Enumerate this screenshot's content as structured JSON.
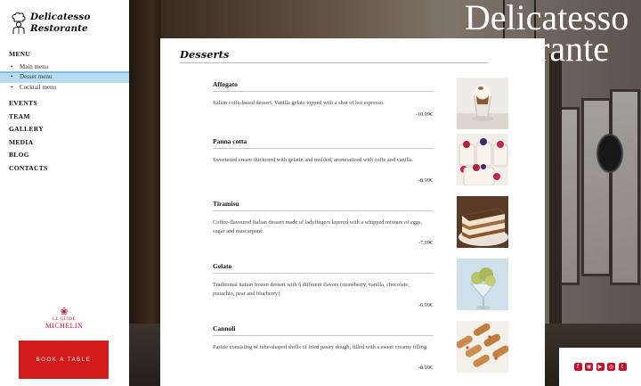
{
  "brand": {
    "line1": "Delicatesso",
    "line2": "Restorante"
  },
  "hero": {
    "line1": "Delicatesso",
    "line2": "rante"
  },
  "nav": {
    "menu": "MENU",
    "menu_items": [
      "Main menu",
      "Desser menu",
      "Cocktail menu"
    ],
    "events": "EVENTS",
    "team": "TEAM",
    "gallery": "GALLERY",
    "media": "MEDIA",
    "blog": "BLOG",
    "contacts": "CONTACTS"
  },
  "michelin": {
    "le_guide": "LE GUIDE",
    "brand": "MICHELIN"
  },
  "book_label": "BOOK A TABLE",
  "section_title": "Desserts",
  "items": [
    {
      "name": "Affogato",
      "desc": "Italian coffe-based dessert. Vanilla gelato topped with a shot of hot espresso.",
      "price": "-10.99€"
    },
    {
      "name": "Panna cotta",
      "desc": "Sweetened cream thickened with gelatin and molded, aromoatized with coffe and vanilla.",
      "price": "-8.99€"
    },
    {
      "name": "Tiramisu",
      "desc": "Coffee-flavoured Italian dessert made of ladyfingers layered with a whipped mixture of eggs, sugar and mascarpone.",
      "price": "-7.99€"
    },
    {
      "name": "Gelato",
      "desc": "Traditional italian frozen dessert with 6 different flavors (strawberry, vanilla, chocolate, pistachio, pear and blueberry).",
      "price": "-6.99€"
    },
    {
      "name": "Cannoli",
      "desc": "Pastrie consisting of tube-shaped shells of fried pastry dough, filled with a sweet creamy filling.",
      "price": "-8.99€"
    }
  ],
  "social_icons": [
    "facebook-icon",
    "instagram-icon",
    "youtube-icon",
    "tripadvisor-icon",
    "twitter-icon"
  ],
  "colors": {
    "accent_red": "#d21c1c",
    "active_highlight": "#b9dcef"
  }
}
